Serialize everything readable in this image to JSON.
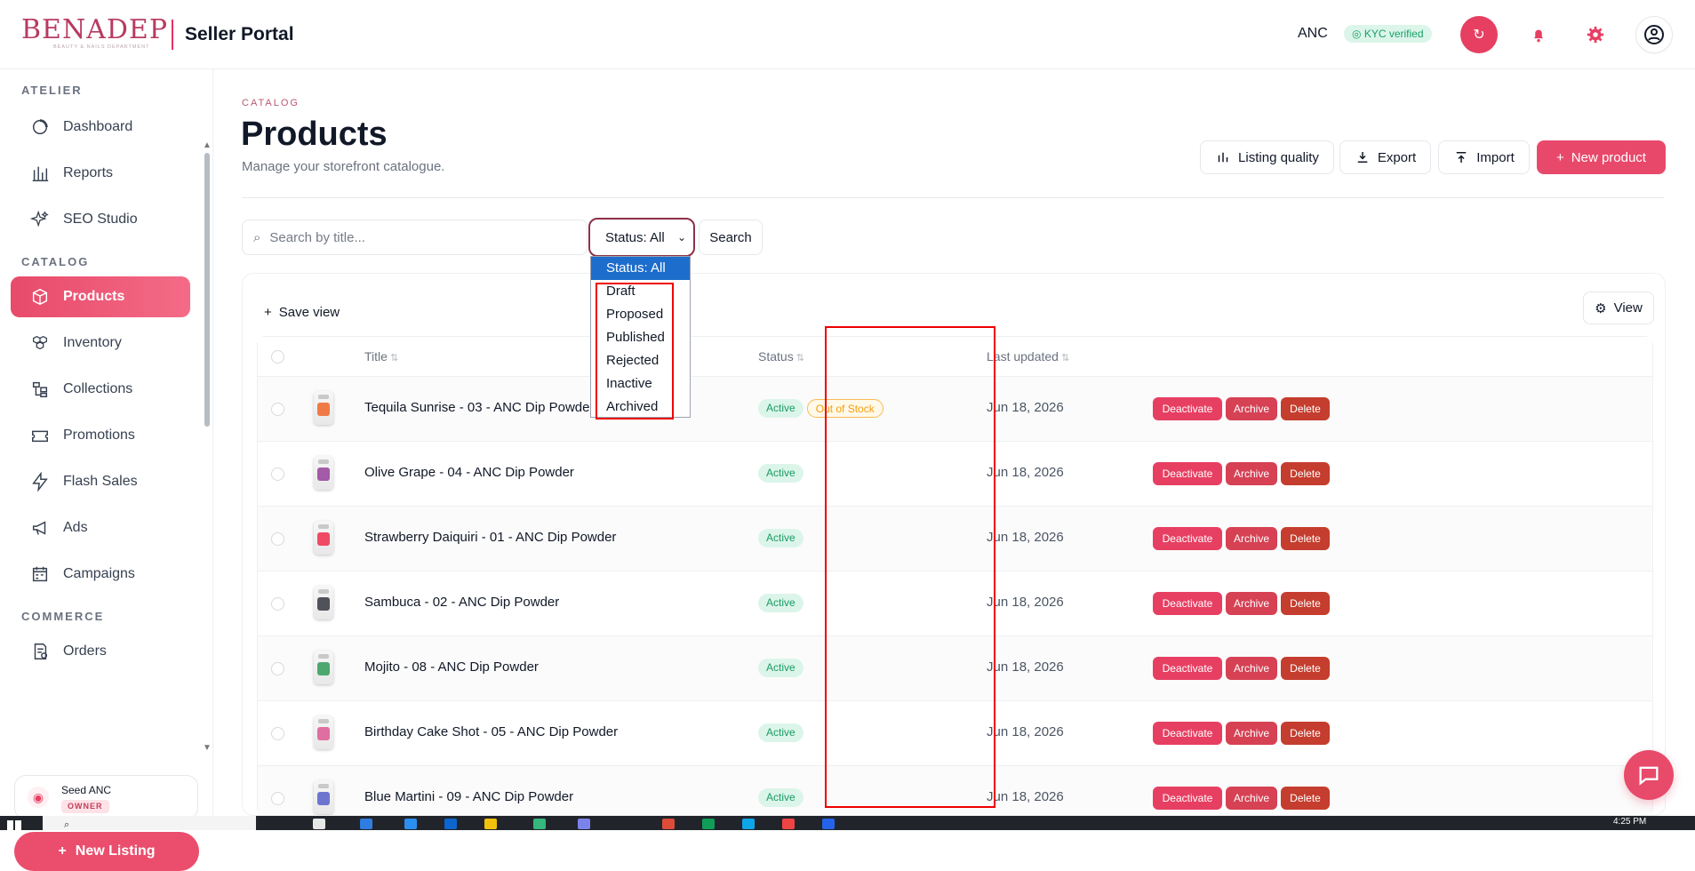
{
  "header": {
    "brand": "BENADEP",
    "brand_subtitle": "BEAUTY & NAILS DEPARTMENT",
    "portal_title": "Seller Portal",
    "user": "ANC",
    "kyc_badge": "KYC verified"
  },
  "sidebar": {
    "sections": {
      "atelier": "ATELIER",
      "catalog": "CATALOG",
      "commerce": "COMMERCE"
    },
    "items": [
      {
        "label": "Dashboard",
        "icon": "dashboard-icon"
      },
      {
        "label": "Reports",
        "icon": "bar-chart-icon"
      },
      {
        "label": "SEO Studio",
        "icon": "sparkle-icon"
      },
      {
        "label": "Products",
        "icon": "box-icon",
        "active": true
      },
      {
        "label": "Inventory",
        "icon": "boxes-icon"
      },
      {
        "label": "Collections",
        "icon": "collections-icon"
      },
      {
        "label": "Promotions",
        "icon": "ticket-icon"
      },
      {
        "label": "Flash Sales",
        "icon": "lightning-icon"
      },
      {
        "label": "Ads",
        "icon": "megaphone-icon"
      },
      {
        "label": "Campaigns",
        "icon": "calendar-icon"
      },
      {
        "label": "Orders",
        "icon": "orders-icon"
      }
    ],
    "account_name": "Seed ANC",
    "account_role": "OWNER",
    "new_listing": "New Listing"
  },
  "page": {
    "overline": "CATALOG",
    "title": "Products",
    "subtitle": "Manage your storefront catalogue.",
    "actions": {
      "listing_quality": "Listing quality",
      "export": "Export",
      "import": "Import",
      "new_product": "New product"
    }
  },
  "filters": {
    "search_placeholder": "Search by title...",
    "status_selected": "Status: All",
    "search_button": "Search",
    "status_options": [
      "Status: All",
      "Draft",
      "Proposed",
      "Published",
      "Rejected",
      "Inactive",
      "Archived"
    ]
  },
  "table": {
    "save_view": "Save view",
    "view": "View",
    "columns": {
      "title": "Title",
      "status": "Status",
      "last_updated": "Last updated"
    },
    "rows": [
      {
        "title": "Tequila Sunrise - 03 - ANC Dip Powder",
        "status": "Active",
        "extra_badge": "Out of Stock",
        "updated": "Jun 18, 2026",
        "swatch": "#f07a45"
      },
      {
        "title": "Olive Grape - 04 - ANC Dip Powder",
        "status": "Active",
        "extra_badge": "",
        "updated": "Jun 18, 2026",
        "swatch": "#a35aa7"
      },
      {
        "title": "Strawberry Daiquiri - 01 - ANC Dip Powder",
        "status": "Active",
        "extra_badge": "",
        "updated": "Jun 18, 2026",
        "swatch": "#ef4b64"
      },
      {
        "title": "Sambuca - 02 - ANC Dip Powder",
        "status": "Active",
        "extra_badge": "",
        "updated": "Jun 18, 2026",
        "swatch": "#4f5258"
      },
      {
        "title": "Mojito - 08 - ANC Dip Powder",
        "status": "Active",
        "extra_badge": "",
        "updated": "Jun 18, 2026",
        "swatch": "#4ca86f"
      },
      {
        "title": "Birthday Cake Shot - 05 - ANC Dip Powder",
        "status": "Active",
        "extra_badge": "",
        "updated": "Jun 18, 2026",
        "swatch": "#e06fa1"
      },
      {
        "title": "Blue Martini - 09 - ANC Dip Powder",
        "status": "Active",
        "extra_badge": "",
        "updated": "Jun 18, 2026",
        "swatch": "#6d75cf"
      }
    ],
    "row_actions": {
      "deactivate": "Deactivate",
      "archive": "Archive",
      "delete": "Delete"
    }
  },
  "taskbar": {
    "time": "4:25 PM"
  },
  "colors": {
    "brand": "#e8496b",
    "active": "#1b9b63",
    "warning": "#f59e0b",
    "selection": "#1d6dcc",
    "annotation": "#e00000"
  }
}
